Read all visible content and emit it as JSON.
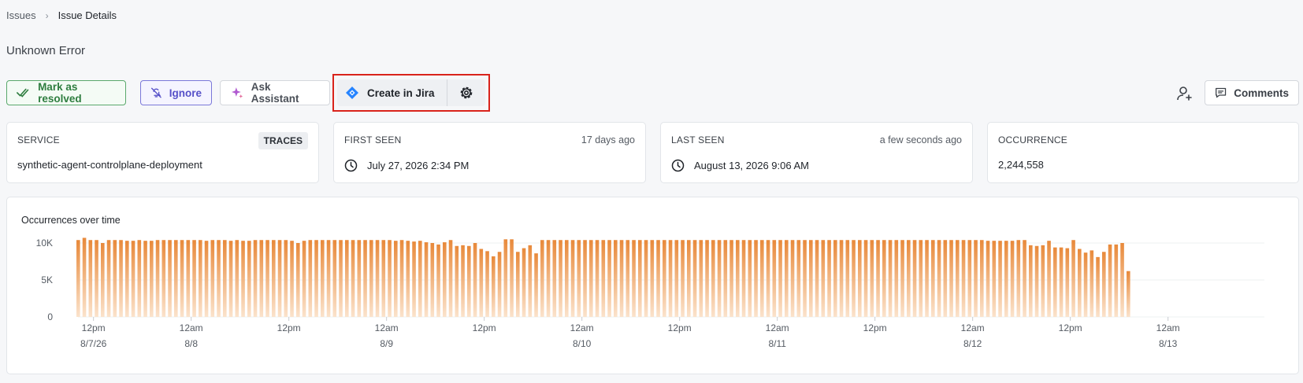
{
  "breadcrumb": {
    "root": "Issues",
    "current": "Issue Details"
  },
  "page_title": "Unknown Error",
  "actions": {
    "resolve_label": "Mark as resolved",
    "ignore_label": "Ignore",
    "assistant_label": "Ask Assistant",
    "jira_label": "Create in Jira",
    "comments_label": "Comments"
  },
  "cards": {
    "service": {
      "label": "SERVICE",
      "badge": "TRACES",
      "value": "synthetic-agent-controlplane-deployment"
    },
    "first_seen": {
      "label": "FIRST SEEN",
      "relative": "17 days ago",
      "value": "July 27, 2026 2:34 PM"
    },
    "last_seen": {
      "label": "LAST SEEN",
      "relative": "a few seconds ago",
      "value": "August 13, 2026 9:06 AM"
    },
    "occurrence": {
      "label": "OCCURRENCE",
      "value": "2,244,558"
    }
  },
  "colors": {
    "bar_top": "#e8893a",
    "bar_bottom": "#fbe3cc",
    "resolve": "#2e7d3f",
    "ignore": "#5650c8",
    "highlight": "#d9231b",
    "jira": "#2684ff"
  },
  "chart_data": {
    "type": "bar",
    "title": "Occurrences over time",
    "ylim": [
      0,
      10800
    ],
    "y_ticks": [
      {
        "value": 0,
        "label": "0"
      },
      {
        "value": 5000,
        "label": "5K"
      },
      {
        "value": 10000,
        "label": "10K"
      }
    ],
    "x_ticks": [
      {
        "index": 2.5,
        "line1": "12pm",
        "line2": "8/7/26"
      },
      {
        "index": 18.5,
        "line1": "12am",
        "line2": "8/8"
      },
      {
        "index": 34.5,
        "line1": "12pm",
        "line2": ""
      },
      {
        "index": 50.5,
        "line1": "12am",
        "line2": "8/9"
      },
      {
        "index": 66.5,
        "line1": "12pm",
        "line2": ""
      },
      {
        "index": 82.5,
        "line1": "12am",
        "line2": "8/10"
      },
      {
        "index": 98.5,
        "line1": "12pm",
        "line2": ""
      },
      {
        "index": 114.5,
        "line1": "12am",
        "line2": "8/11"
      },
      {
        "index": 130.5,
        "line1": "12pm",
        "line2": ""
      },
      {
        "index": 146.5,
        "line1": "12am",
        "line2": "8/12"
      },
      {
        "index": 162.5,
        "line1": "12pm",
        "line2": ""
      },
      {
        "index": 178.5,
        "line1": "12am",
        "line2": "8/13"
      }
    ],
    "values": [
      10400,
      10700,
      10400,
      10400,
      10000,
      10400,
      10400,
      10400,
      10300,
      10300,
      10400,
      10300,
      10300,
      10400,
      10400,
      10400,
      10400,
      10400,
      10400,
      10400,
      10400,
      10300,
      10400,
      10400,
      10400,
      10300,
      10400,
      10300,
      10300,
      10400,
      10400,
      10400,
      10400,
      10400,
      10400,
      10300,
      10000,
      10300,
      10400,
      10400,
      10400,
      10400,
      10400,
      10400,
      10400,
      10400,
      10400,
      10400,
      10400,
      10400,
      10400,
      10400,
      10300,
      10400,
      10300,
      10200,
      10300,
      10100,
      10000,
      9800,
      10100,
      10400,
      9600,
      9700,
      9600,
      10000,
      9200,
      8900,
      8200,
      8800,
      10500,
      10500,
      8800,
      9300,
      9700,
      8600,
      10400,
      10400,
      10400,
      10400,
      10400,
      10400,
      10400,
      10400,
      10400,
      10400,
      10400,
      10400,
      10400,
      10400,
      10400,
      10400,
      10400,
      10400,
      10400,
      10400,
      10400,
      10400,
      10400,
      10400,
      10400,
      10400,
      10400,
      10400,
      10400,
      10400,
      10400,
      10400,
      10400,
      10400,
      10400,
      10400,
      10400,
      10400,
      10400,
      10400,
      10400,
      10400,
      10400,
      10400,
      10400,
      10400,
      10400,
      10400,
      10400,
      10400,
      10400,
      10400,
      10400,
      10400,
      10400,
      10400,
      10400,
      10400,
      10400,
      10400,
      10400,
      10400,
      10400,
      10400,
      10400,
      10400,
      10400,
      10400,
      10400,
      10400,
      10400,
      10400,
      10400,
      10300,
      10300,
      10300,
      10300,
      10300,
      10400,
      10400,
      9700,
      9600,
      9700,
      10300,
      9400,
      9400,
      9300,
      10400,
      9200,
      8700,
      9000,
      8100,
      8800,
      9800,
      9800,
      10000,
      6200
    ]
  }
}
